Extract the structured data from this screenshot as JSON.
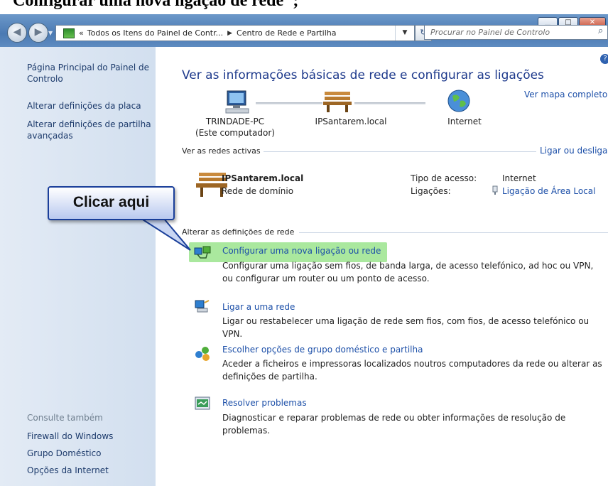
{
  "doc_title": "Configurar uma nova ligação de rede\";",
  "window_controls": {
    "minimize": "▁",
    "maximize": "□",
    "close": "✕"
  },
  "address_bar": {
    "chevron": "«",
    "crumbs": [
      "Todos os Itens do Painel de Contr...",
      "Centro de Rede e Partilha"
    ],
    "separator": "▶",
    "search_placeholder": "Procurar no Painel de Controlo"
  },
  "sidebar": {
    "links": [
      "Página Principal do Painel de Controlo",
      "Alterar definições da placa",
      "Alterar definições de partilha avançadas"
    ],
    "see_also_heading": "Consulte também",
    "see_also": [
      "Firewall do Windows",
      "Grupo Doméstico",
      "Opções da Internet"
    ]
  },
  "main": {
    "title": "Ver as informações básicas de rede e configurar as ligações",
    "map_link": "Ver mapa completo",
    "nodes": [
      {
        "label": "TRINDADE-PC",
        "sublabel": "(Este computador)"
      },
      {
        "label": "IPSantarem.local"
      },
      {
        "label": "Internet"
      }
    ],
    "active_networks": {
      "heading": "Ver as redes activas",
      "link": "Ligar ou desligar",
      "name": "IPSantarem.local",
      "type": "Rede de domínio",
      "access_label": "Tipo de acesso:",
      "access_value": "Internet",
      "connections_label": "Ligações:",
      "connections_value": "Ligação de Área Local"
    },
    "change_settings": {
      "heading": "Alterar as definições de rede",
      "tasks": [
        {
          "title": "Configurar uma nova ligação ou rede",
          "desc": "Configurar uma ligação sem fios, de banda larga, de acesso telefónico, ad hoc ou VPN, ou configurar um router ou um ponto de acesso.",
          "icon": "new-connection-icon"
        },
        {
          "title": "Ligar a uma rede",
          "desc": "Ligar ou restabelecer uma ligação de rede sem fios, com fios, de acesso telefónico ou VPN.",
          "icon": "connect-network-icon"
        },
        {
          "title": "Escolher opções de grupo doméstico e partilha",
          "desc": "Aceder a ficheiros e impressoras localizados noutros computadores da rede ou alterar as definições de partilha.",
          "icon": "homegroup-icon"
        },
        {
          "title": "Resolver problemas",
          "desc": "Diagnosticar e reparar problemas de rede ou obter informações de resolução de problemas.",
          "icon": "troubleshoot-icon"
        }
      ]
    }
  },
  "callout": {
    "text": "Clicar aqui"
  },
  "colors": {
    "link": "#1c4fa8",
    "title": "#1e3a8c",
    "highlight": "#8ee07e",
    "sidebar": "#d9e4f2"
  }
}
